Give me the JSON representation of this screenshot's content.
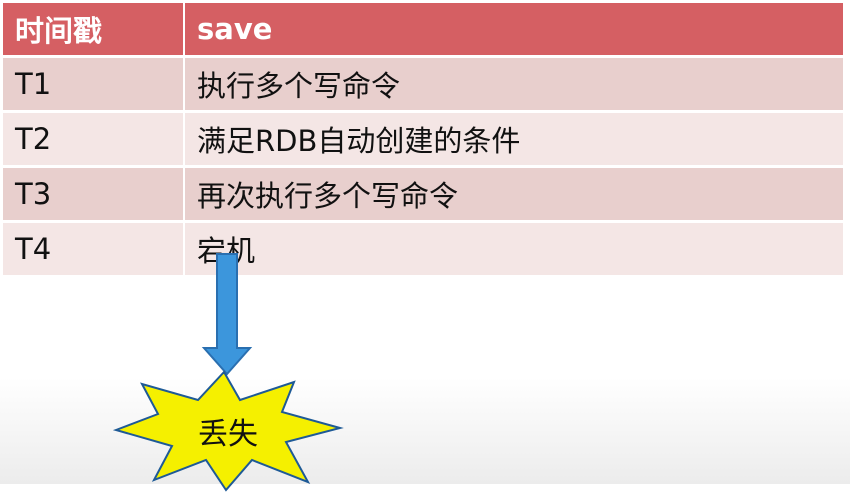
{
  "table": {
    "headers": [
      "时间戳",
      "save"
    ],
    "rows": [
      {
        "time": "T1",
        "event": "执行多个写命令"
      },
      {
        "time": "T2",
        "event": "满足RDB自动创建的条件"
      },
      {
        "time": "T3",
        "event": "再次执行多个写命令"
      },
      {
        "time": "T4",
        "event": "宕机"
      }
    ]
  },
  "callout": {
    "label": "丢失",
    "icon": "down-arrow-icon",
    "shape": "explosion-burst",
    "arrow_color": "#3c96dc",
    "burst_color": "#f5f000"
  },
  "colors": {
    "header_bg": "#d55f63",
    "row_odd_bg": "#e8cfcd",
    "row_even_bg": "#f4e6e5"
  }
}
